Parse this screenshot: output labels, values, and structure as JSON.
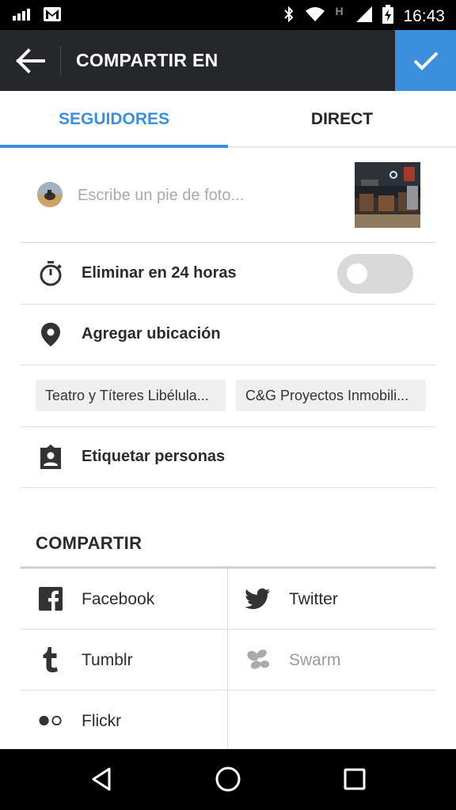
{
  "status_bar": {
    "time": "16:43",
    "icons": [
      "signal-bars-icon",
      "gmail-icon",
      "bluetooth-icon",
      "wifi-icon",
      "h-network-icon",
      "cell-signal-icon",
      "battery-charging-icon"
    ],
    "network_letter": "H"
  },
  "appbar": {
    "title": "COMPARTIR EN",
    "back_icon": "arrow-back-icon",
    "confirm_icon": "checkmark-icon",
    "accent_color": "#3b8fdd"
  },
  "tabs": [
    {
      "label": "SEGUIDORES",
      "selected": true
    },
    {
      "label": "DIRECT",
      "selected": false
    }
  ],
  "caption": {
    "placeholder": "Escribe un pie de foto..."
  },
  "options": {
    "timer": {
      "label": "Eliminar en 24 horas",
      "icon": "stopwatch-icon",
      "toggle_on": false
    },
    "location": {
      "label": "Agregar ubicación",
      "icon": "location-pin-icon"
    },
    "location_suggestions": [
      "Teatro y Títeres Libélula...",
      "C&G Proyectos Inmobili..."
    ],
    "tag": {
      "label": "Etiquetar personas",
      "icon": "tag-person-icon"
    }
  },
  "share": {
    "header": "COMPARTIR",
    "services": [
      {
        "label": "Facebook",
        "icon": "facebook-icon",
        "enabled": true
      },
      {
        "label": "Twitter",
        "icon": "twitter-icon",
        "enabled": true
      },
      {
        "label": "Tumblr",
        "icon": "tumblr-icon",
        "enabled": true
      },
      {
        "label": "Swarm",
        "icon": "swarm-icon",
        "enabled": false
      },
      {
        "label": "Flickr",
        "icon": "flickr-icon",
        "enabled": true
      }
    ]
  },
  "navbar": {
    "icons": [
      "back-triangle-icon",
      "home-circle-icon",
      "recents-square-icon"
    ]
  }
}
